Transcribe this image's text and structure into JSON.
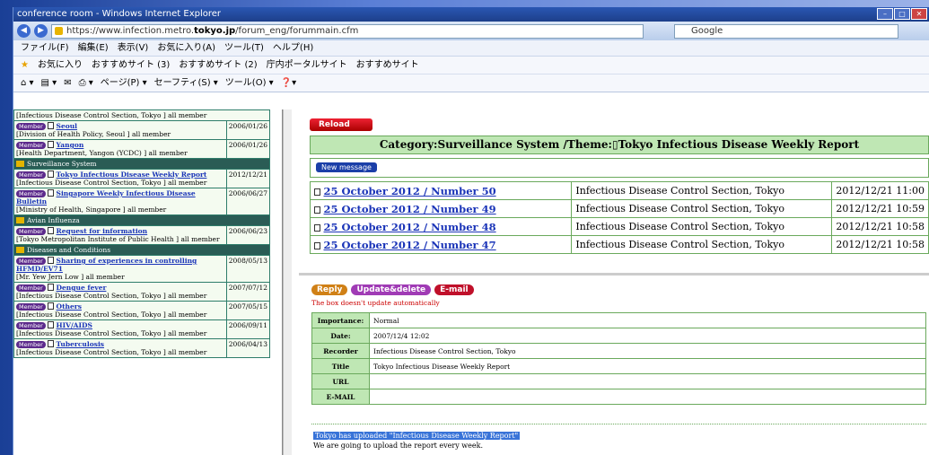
{
  "window": {
    "title": "conference room - Windows Internet Explorer",
    "url_prefix": "https://www.infection.metro.",
    "url_host": "tokyo.jp",
    "url_path": "/forum_eng/forummain.cfm",
    "search": "Google"
  },
  "menu": [
    "ファイル(F)",
    "編集(E)",
    "表示(V)",
    "お気に入り(A)",
    "ツール(T)",
    "ヘルプ(H)"
  ],
  "favorites": [
    "お気に入り",
    "おすすめサイト (3)",
    "おすすめサイト (2)",
    "庁内ポータルサイト",
    "おすすめサイト"
  ],
  "tools": [
    "ページ(P) ▾",
    "セーフティ(S) ▾",
    "ツール(O) ▾"
  ],
  "left": {
    "top_stub": "[Infectious Disease Control Section, Tokyo ] all member",
    "badge": "Member",
    "rows": [
      {
        "type": "item",
        "title": "Seoul",
        "sub": "[Division of Health Policy, Seoul ] all member",
        "date": "2006/01/26"
      },
      {
        "type": "item",
        "title": "Yangon",
        "sub": "[Health Department, Yangon (YCDC) ] all member",
        "date": "2006/01/26"
      },
      {
        "type": "cat",
        "label": "Surveillance System"
      },
      {
        "type": "item",
        "title": "Tokyo Infectious Disease Weekly Report",
        "sub": "[Infectious Disease Control Section, Tokyo ] all member",
        "date": "2012/12/21"
      },
      {
        "type": "item",
        "title": "Singapore Weekly Infectious Disease Bulletin",
        "sub": "[Ministry of Health, Singapore ] all member",
        "date": "2006/06/27"
      },
      {
        "type": "cat",
        "label": "Avian Influenza"
      },
      {
        "type": "item",
        "title": "Request for information",
        "sub": "[Tokyo Metropolitan Institute of Public Health ] all member",
        "date": "2006/06/23"
      },
      {
        "type": "cat",
        "label": "Diseases and Conditions"
      },
      {
        "type": "item",
        "title": "Sharing of experiences in controlling HFMD/EV71",
        "sub": "[Mr. Yew Jern Low ] all member",
        "date": "2008/05/13"
      },
      {
        "type": "item",
        "title": "Dengue fever",
        "sub": "[Infectious Disease Control Section, Tokyo ] all member",
        "date": "2007/07/12"
      },
      {
        "type": "item",
        "title": "Others",
        "sub": "[Infectious Disease Control Section, Tokyo ] all member",
        "date": "2007/05/15"
      },
      {
        "type": "item",
        "title": "HIV/AIDS",
        "sub": "[Infectious Disease Control Section, Tokyo ] all member",
        "date": "2006/09/11"
      },
      {
        "type": "item",
        "title": "Tuberculosis",
        "sub": "[Infectious Disease Control Section, Tokyo ] all member",
        "date": "2006/04/13"
      }
    ]
  },
  "right": {
    "reload": "Reload",
    "category_title": "Category:Surveillance System /Theme:▯Tokyo Infectious Disease Weekly Report",
    "new_message": "New message",
    "messages": [
      {
        "title": "25 October 2012 / Number 50",
        "sender": "Infectious Disease Control Section, Tokyo",
        "date": "2012/12/21  11:00"
      },
      {
        "title": "25 October 2012 / Number 49",
        "sender": "Infectious Disease Control Section, Tokyo",
        "date": "2012/12/21  10:59"
      },
      {
        "title": "25 October 2012 / Number 48",
        "sender": "Infectious Disease Control Section, Tokyo",
        "date": "2012/12/21  10:58"
      },
      {
        "title": "25 October 2012 / Number 47",
        "sender": "Infectious Disease Control Section, Tokyo",
        "date": "2012/12/21  10:58"
      }
    ],
    "actions": {
      "reply": "Reply",
      "update": "Update&delete",
      "email": "E-mail"
    },
    "note": "The box doesn't update automatically",
    "details": [
      {
        "k": "Importance:",
        "v": "Normal"
      },
      {
        "k": "Date:",
        "v": "2007/12/4  12:02"
      },
      {
        "k": "Recorder",
        "v": "Infectious Disease Control Section, Tokyo"
      },
      {
        "k": "Title",
        "v": "Tokyo Infectious Disease Weekly Report"
      },
      {
        "k": "URL",
        "v": ""
      },
      {
        "k": "E-MAIL",
        "v": ""
      }
    ],
    "body_line1": "Tokyo has uploaded \"Infectious Disease Weekly Report\"",
    "body_line2": "We are going to upload the report every week."
  }
}
